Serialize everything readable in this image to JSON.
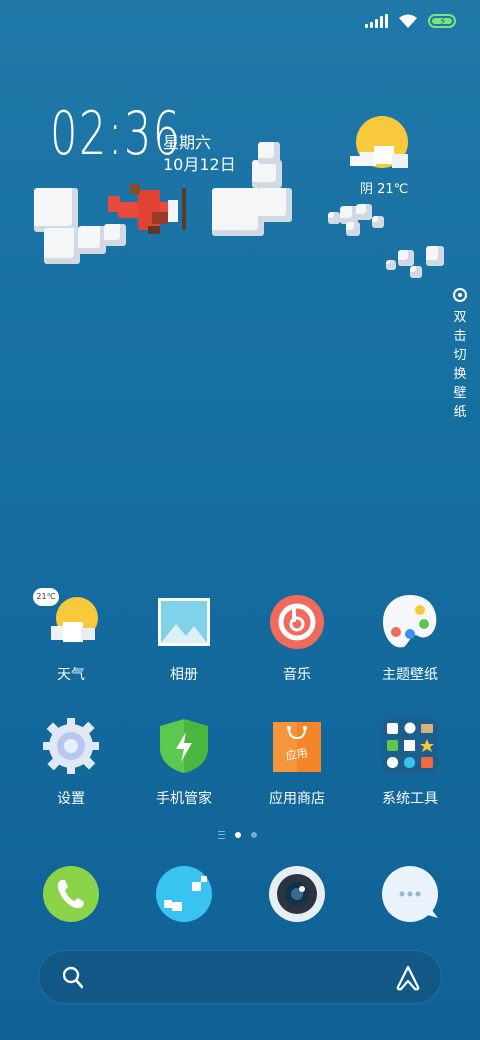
{
  "status_bar": {
    "signal": "signal-icon",
    "wifi": "wifi-icon",
    "battery": "battery-charging-icon",
    "battery_color": "#7ee27e"
  },
  "clock_widget": {
    "time": "02:36",
    "weekday": "星期六",
    "date": "10月12日",
    "weather": "阴 21℃"
  },
  "switch_wallpaper": {
    "label": "双击切换壁纸"
  },
  "apps": [
    {
      "label": "天气",
      "icon": "weather-icon",
      "badge": "21℃"
    },
    {
      "label": "相册",
      "icon": "gallery-icon"
    },
    {
      "label": "音乐",
      "icon": "music-icon"
    },
    {
      "label": "主题壁纸",
      "icon": "themes-icon"
    },
    {
      "label": "设置",
      "icon": "settings-icon"
    },
    {
      "label": "手机管家",
      "icon": "security-icon"
    },
    {
      "label": "应用商店",
      "icon": "app-store-icon",
      "bag_text": "应用"
    },
    {
      "label": "系统工具",
      "icon": "tools-folder-icon"
    }
  ],
  "page_indicator": {
    "pages": 2,
    "current": 1
  },
  "dock": [
    {
      "icon": "phone-icon",
      "color": "#8bd44a"
    },
    {
      "icon": "browser-icon",
      "color": "#39c3f0"
    },
    {
      "icon": "camera-icon",
      "color": "#e8eef4"
    },
    {
      "icon": "messages-icon",
      "color": "#eaf2fb"
    }
  ],
  "search_bar": {
    "placeholder": "",
    "icon": "search-icon",
    "assistant_icon": "assistant-icon"
  },
  "colors": {
    "background_top": "#1f78a8",
    "background_bottom": "#0f6196",
    "music_red": "#f26a5c",
    "security_green": "#5cc94e",
    "store_orange": "#f7953a"
  }
}
